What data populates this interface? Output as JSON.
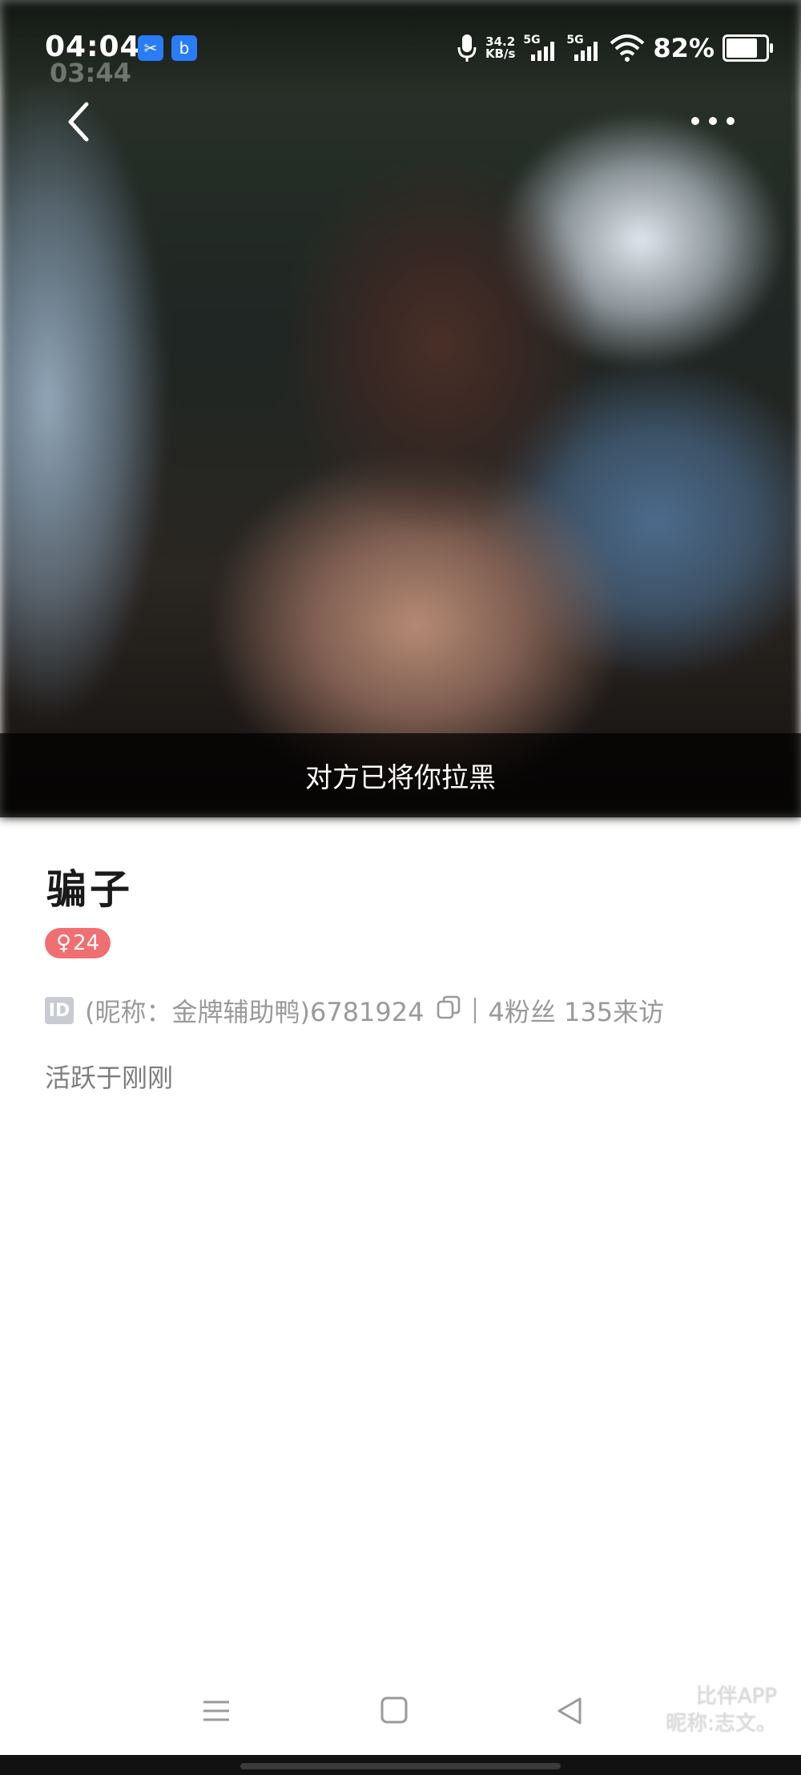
{
  "status_bar": {
    "time": "04:04",
    "time_ghost": "03:44",
    "speed_value": "34.2",
    "speed_unit": "KB/s",
    "network_1": "5G",
    "network_2": "5G",
    "battery": "82%",
    "battery_level": 0.82
  },
  "header": {
    "back_icon": "chevron-left-icon",
    "more_icon": "more-dots-icon"
  },
  "banner": {
    "blocked_text": "对方已将你拉黑"
  },
  "profile": {
    "name": "骗子",
    "gender_symbol": "♀",
    "age": "24",
    "id_icon_label": "ID",
    "id_text": "(昵称：金牌辅助鸭)6781924",
    "fans_text": "4粉丝 135来访",
    "active_text": "活跃于刚刚"
  },
  "watermark": {
    "line1": "比伴APP",
    "line2": "昵称:志文。"
  },
  "colors": {
    "gender_badge": "#ef6f72",
    "secondary_text": "#9a9a9a",
    "id_badge": "#c9cbd3"
  }
}
